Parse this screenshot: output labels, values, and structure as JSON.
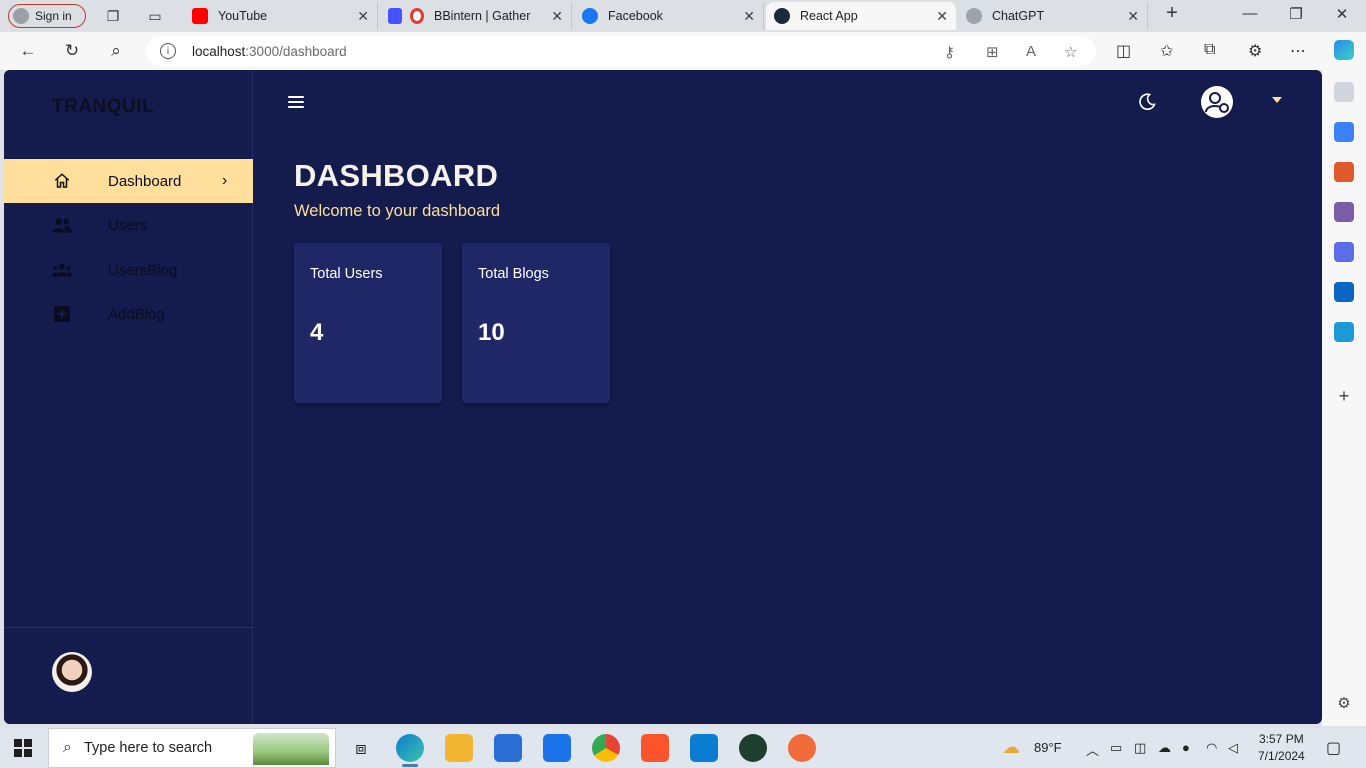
{
  "browser": {
    "profile_label": "Sign in",
    "tabs": [
      {
        "title": "YouTube",
        "color": "#ff0000"
      },
      {
        "title": "BBintern | Gather",
        "color": "#4353ff"
      },
      {
        "title": "Facebook",
        "color": "#1877f2"
      },
      {
        "title": "React App",
        "color": "#1b2a3a"
      },
      {
        "title": "ChatGPT",
        "color": "#9ca3af"
      }
    ],
    "active_tab": "React App",
    "url_host": "localhost",
    "url_path": ":3000/dashboard"
  },
  "app": {
    "brand": "TRANQUIL",
    "nav": [
      {
        "label": "Dashboard",
        "icon": "home-icon",
        "active": true
      },
      {
        "label": "Users",
        "icon": "users-icon",
        "active": false
      },
      {
        "label": "UsersBlog",
        "icon": "groups-icon",
        "active": false
      },
      {
        "label": "AddBlog",
        "icon": "add-box-icon",
        "active": false
      }
    ],
    "title": "DASHBOARD",
    "subtitle": "Welcome to your dashboard",
    "cards": [
      {
        "title": "Total Users",
        "value": "4"
      },
      {
        "title": "Total Blogs",
        "value": "10"
      }
    ],
    "colors": {
      "background": "#141b4d",
      "accent": "#ffdf9b",
      "card": "#1f2766"
    }
  },
  "taskbar": {
    "search_placeholder": "Type here to search",
    "weather": "89°F",
    "time": "3:57 PM",
    "date": "7/1/2024"
  }
}
